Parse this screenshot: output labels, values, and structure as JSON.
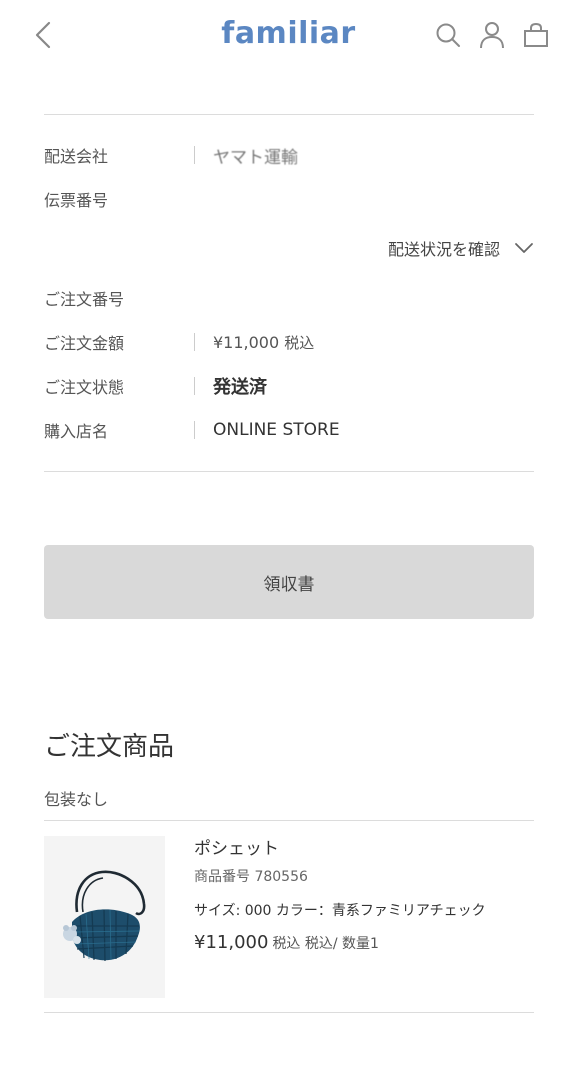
{
  "header": {
    "logo_text": "familiar",
    "logo_color": "#5b87c2",
    "icons": [
      "chevron-left-icon",
      "search-icon",
      "user-icon",
      "bag-icon"
    ]
  },
  "shipping": {
    "carrier_label": "配送会社",
    "carrier_value": "ヤマト運輸",
    "tracking_label": "伝票番号",
    "tracking_value": "",
    "track_link": "配送状況を確認"
  },
  "order": {
    "number_label": "ご注文番号",
    "number_value": "",
    "amount_label": "ご注文金額",
    "amount_value": "¥11,000",
    "amount_tax": "税込",
    "status_label": "ご注文状態",
    "status_value": "発送済",
    "store_label": "購入店名",
    "store_value": "ONLINE STORE"
  },
  "receipt_button": "領収書",
  "items_section": {
    "title": "ご注文商品",
    "wrapping": "包装なし",
    "item": {
      "name": "ポシェット",
      "code": "商品番号 780556",
      "options": "サイズ: 000 カラー：青系ファミリアチェック",
      "price": "¥11,000",
      "price_note": "税込 税込/ 数量1"
    }
  }
}
